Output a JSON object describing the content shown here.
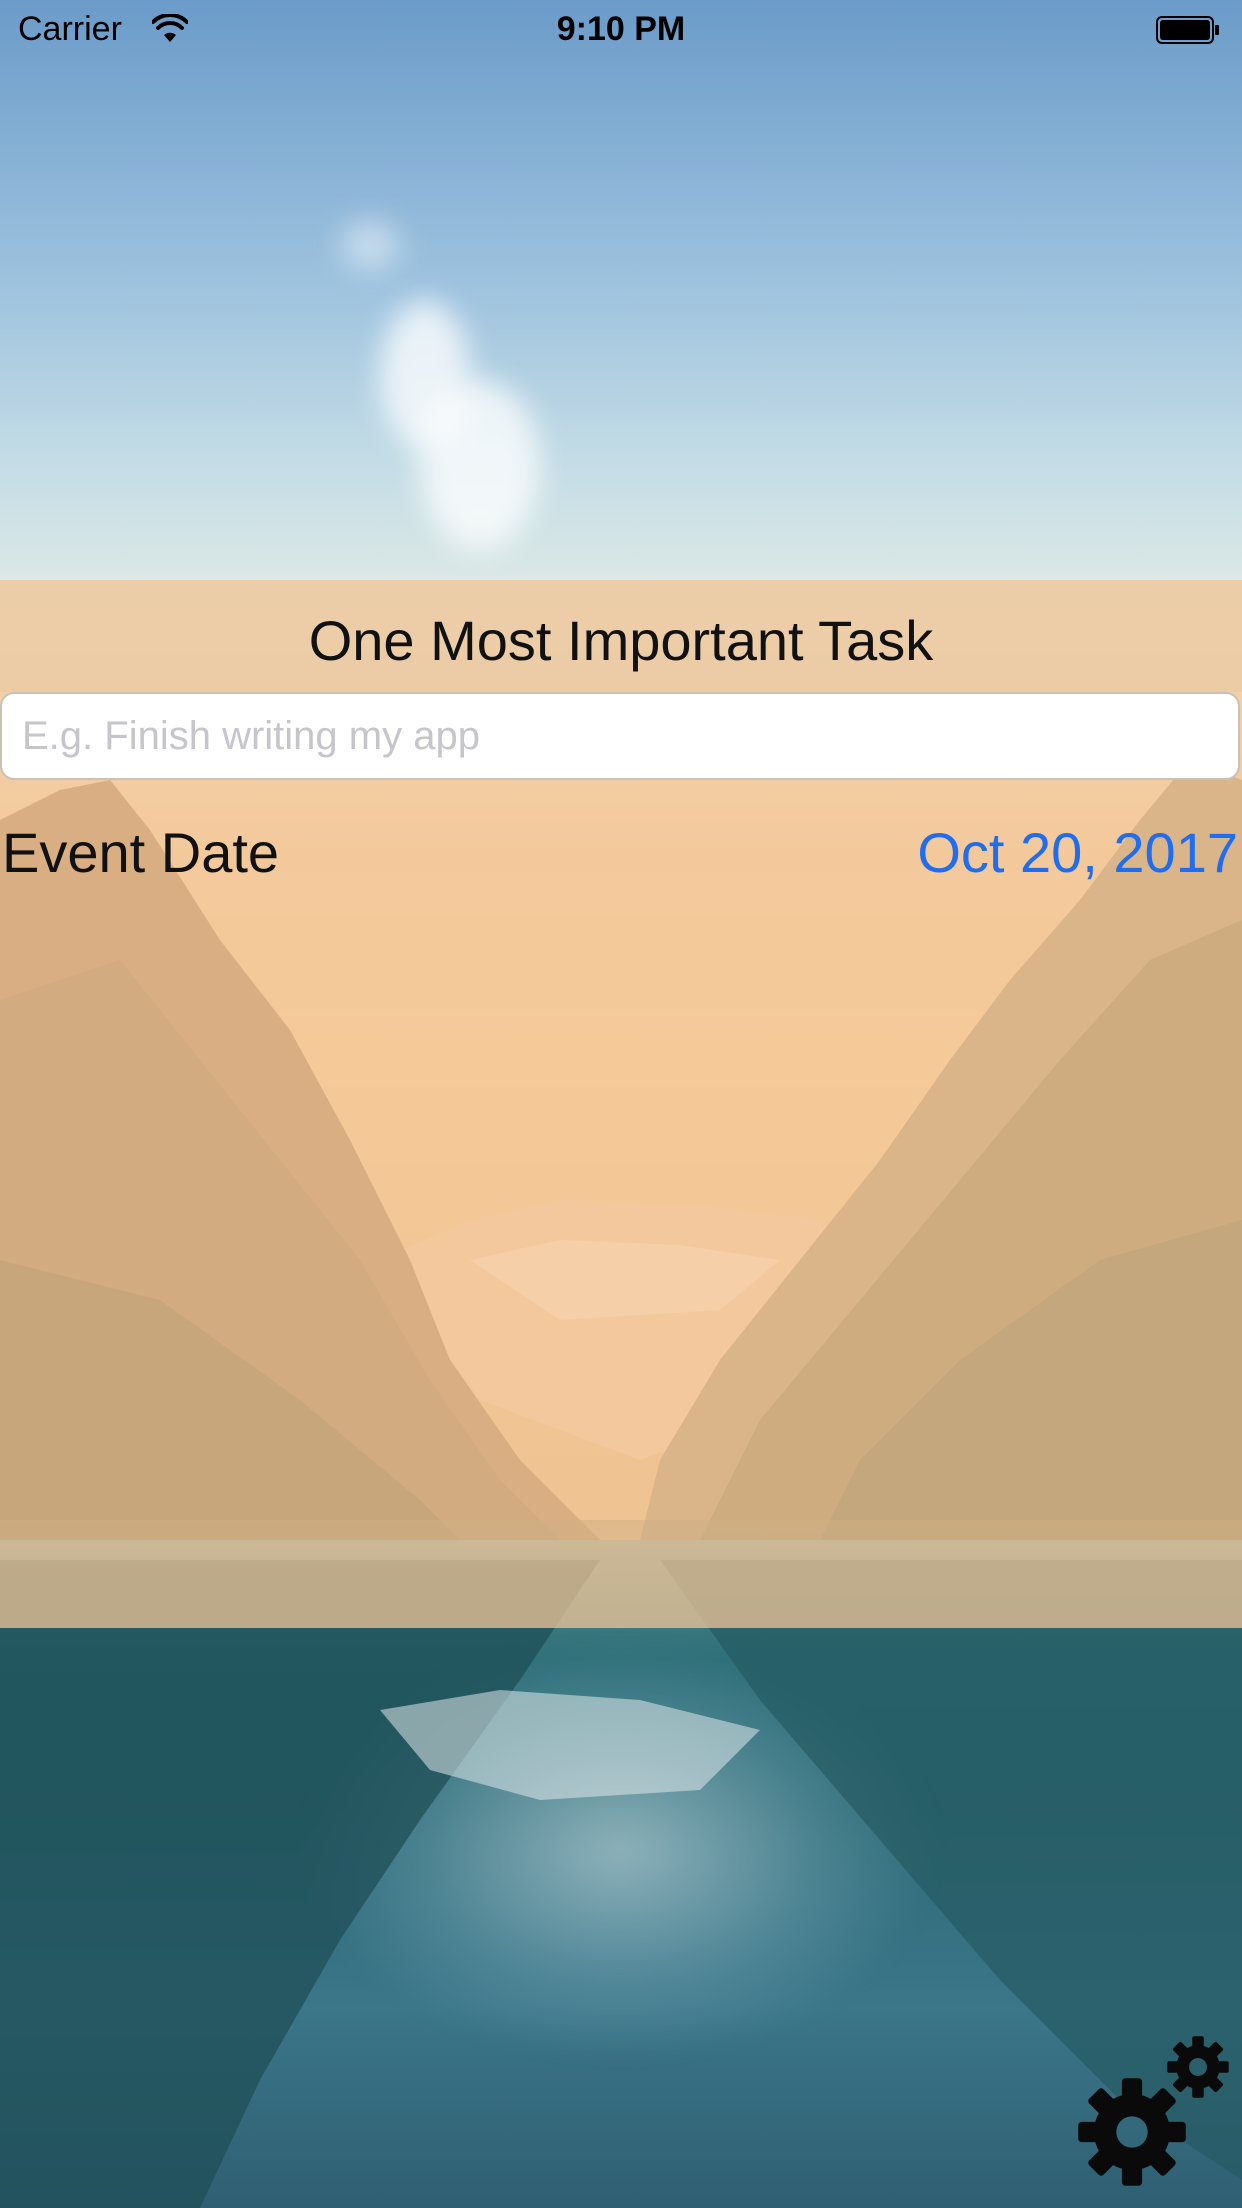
{
  "status_bar": {
    "carrier": "Carrier",
    "time": "9:10 PM",
    "wifi_icon": "wifi-icon",
    "battery_icon": "battery-full-icon"
  },
  "task": {
    "title": "One Most Important Task",
    "input_value": "",
    "input_placeholder": "E.g. Finish writing my app"
  },
  "event": {
    "label": "Event Date",
    "date": "Oct 20, 2017"
  },
  "settings": {
    "icon": "gear-icon"
  },
  "colors": {
    "date_accent": "#1f6df0",
    "panel_tint": "#f7c998"
  }
}
